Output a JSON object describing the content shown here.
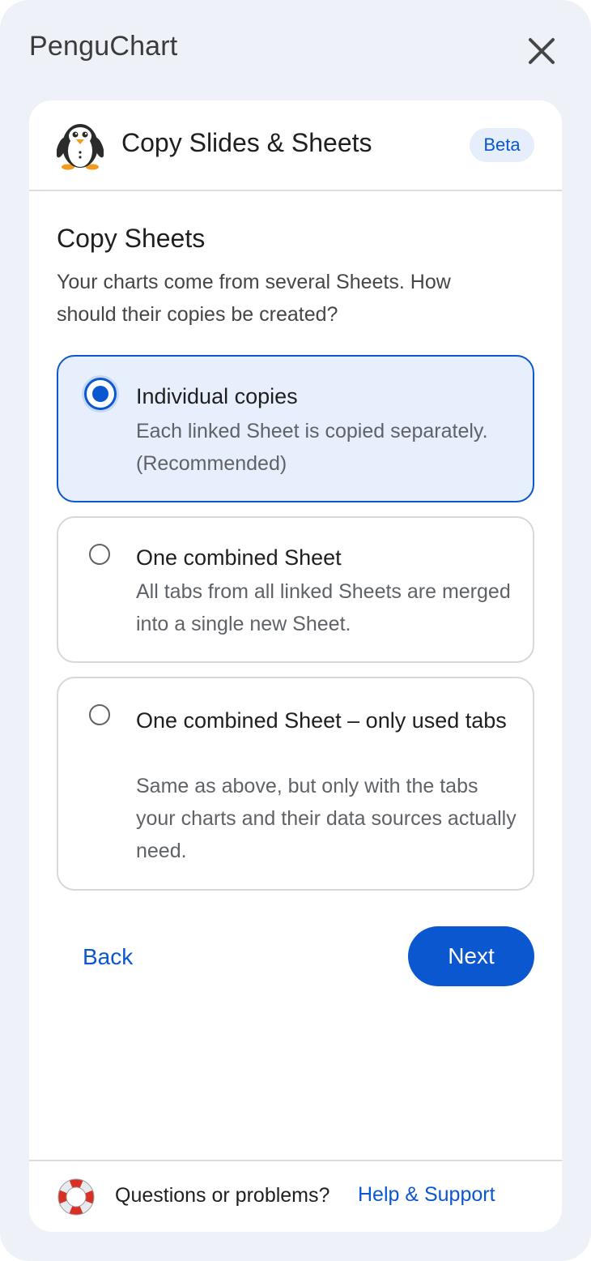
{
  "app": {
    "title": "PenguChart"
  },
  "card": {
    "title": "Copy Slides & Sheets",
    "badge": "Beta"
  },
  "section": {
    "title": "Copy Sheets",
    "description": "Your charts come from several Sheets. How should their copies be created?"
  },
  "options": [
    {
      "label": "Individual copies",
      "description": "Each linked Sheet is copied separately. (Recommended)",
      "selected": true
    },
    {
      "label": "One combined Sheet",
      "description": "All tabs from all linked Sheets are merged into a single new Sheet.",
      "selected": false
    },
    {
      "label": "One combined Sheet – only used tabs",
      "description": "Same as above, but only with the tabs your charts and their data sources actually need.",
      "selected": false
    }
  ],
  "actions": {
    "back_label": "Back",
    "next_label": "Next"
  },
  "footer": {
    "text": "Questions or problems?",
    "link_label": "Help & Support"
  },
  "icons": {
    "close": "close-icon",
    "logo": "penguin-logo",
    "help": "lifebuoy-icon"
  },
  "colors": {
    "accent": "#0b57d0",
    "panel_bg": "#eef2f8",
    "selected_bg": "#e8effc"
  }
}
